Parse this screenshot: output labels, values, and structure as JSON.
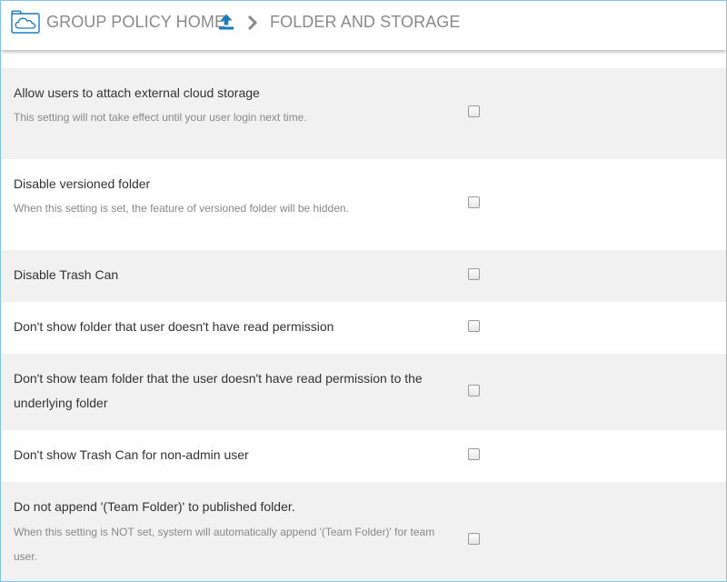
{
  "header": {
    "home_label": "GROUP POLICY HOME",
    "current_label": "FOLDER AND STORAGE",
    "home_icon": "cloud-folder-icon",
    "upload_icon": "upload-icon",
    "separator_icon": "chevron-right-icon",
    "accent_color": "#1a7abf"
  },
  "settings": [
    {
      "title": "Allow users to attach external cloud storage",
      "description": "This setting will not take effect until your user login next time.",
      "checked": false
    },
    {
      "title": "Disable versioned folder",
      "description": "When this setting is set, the feature of versioned folder will be hidden.",
      "checked": false
    },
    {
      "title": "Disable Trash Can",
      "description": "",
      "checked": false
    },
    {
      "title": "Don't show folder that user doesn't have read permission",
      "description": "",
      "checked": false
    },
    {
      "title": "Don't show team folder that the user doesn't have read permission to the underlying folder",
      "description": "",
      "checked": false
    },
    {
      "title": "Don't show Trash Can for non-admin user",
      "description": "",
      "checked": false
    },
    {
      "title": "Do not append '(Team Folder)' to published folder.",
      "description": "When this setting is NOT set, system will automatically append '(Team Folder)' for team user.",
      "checked": false
    }
  ]
}
